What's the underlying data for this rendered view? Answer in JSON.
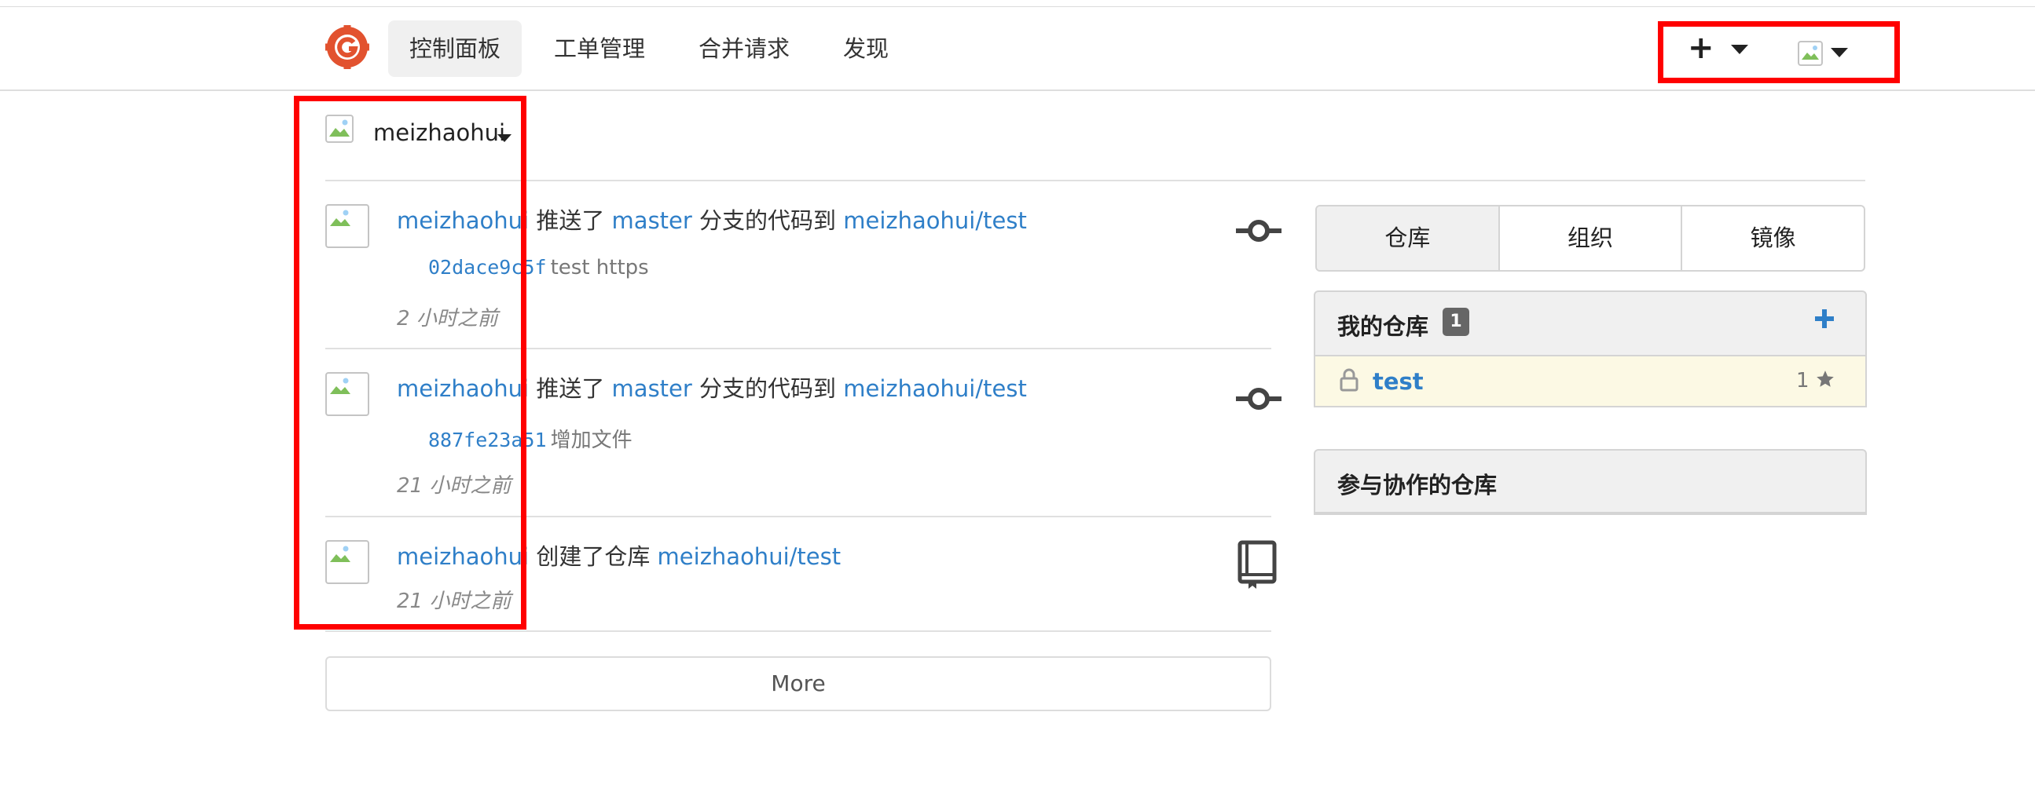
{
  "header": {
    "nav": [
      {
        "label": "控制面板"
      },
      {
        "label": "工单管理"
      },
      {
        "label": "合并请求"
      },
      {
        "label": "发现"
      }
    ],
    "create_label": "+"
  },
  "context": {
    "username": "meizhaohui"
  },
  "feed": [
    {
      "user": "meizhaohui",
      "action1": "推送了",
      "branch": "master",
      "action2": "分支的代码到",
      "repo": "meizhaohui/test",
      "commit_sha": "02dace9c5f",
      "commit_msg": "test https",
      "time": "2 小时之前",
      "icon": "commit-icon"
    },
    {
      "user": "meizhaohui",
      "action1": "推送了",
      "branch": "master",
      "action2": "分支的代码到",
      "repo": "meizhaohui/test",
      "commit_sha": "887fe23a51",
      "commit_msg": "增加文件",
      "time": "21 小时之前",
      "icon": "commit-icon"
    },
    {
      "user": "meizhaohui",
      "action1": "创建了仓库",
      "repo": "meizhaohui/test",
      "time": "21 小时之前",
      "icon": "repo-book-icon"
    }
  ],
  "more_label": "More",
  "sidebar": {
    "tabs": [
      {
        "label": "仓库"
      },
      {
        "label": "组织"
      },
      {
        "label": "镜像"
      }
    ],
    "my_repos": {
      "title": "我的仓库",
      "count": "1",
      "repos": [
        {
          "name": "test",
          "stars": "1",
          "private": true
        }
      ]
    },
    "collab_repos": {
      "title": "参与协作的仓库"
    }
  },
  "colors": {
    "link": "#2f7fc8",
    "highlight_box": "#ff0000",
    "logo": "#e2522f"
  }
}
